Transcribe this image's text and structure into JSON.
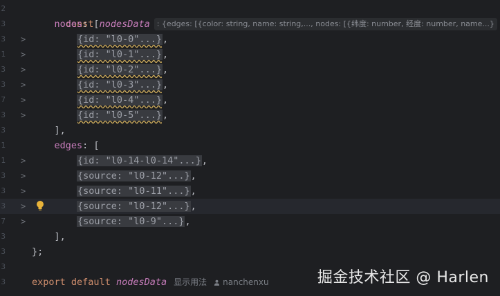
{
  "editor": {
    "line1": {
      "keyword": "const",
      "var": "nodesData",
      "hint": ": {edges: [{color: string, name: string,..., nodes: [{纬度: number, 经度: number, name...}",
      "assign": "= {"
    },
    "nodes_label": "nodes",
    "nodes": [
      "{id: \"l0-0\"...}",
      "{id: \"l0-1\"...}",
      "{id: \"l0-2\"...}",
      "{id: \"l0-3\"...}",
      "{id: \"l0-4\"...}",
      "{id: \"l0-5\"...}"
    ],
    "edges_label": "edges",
    "edges": [
      "{id: \"l0-14-l0-14\"...}",
      "{source: \"l0-12\"...}",
      "{source: \"l0-11\"...}",
      "{source: \"l0-12\"...}",
      "{source: \"l0-9\"...}"
    ],
    "close_bracket": "],",
    "close_obj": "};",
    "export_line": {
      "kw1": "export",
      "kw2": "default",
      "var": "nodesData",
      "usage": "显示用法",
      "author": "nanchenxu"
    }
  },
  "gutter": [
    "2",
    "3",
    "3",
    "1",
    "3",
    "3",
    "7",
    "3",
    "3",
    "1",
    "1",
    "3",
    "3",
    "3",
    "7",
    "3",
    "3",
    "3",
    "3"
  ],
  "watermark": "掘金技术社区 @ Harlen"
}
